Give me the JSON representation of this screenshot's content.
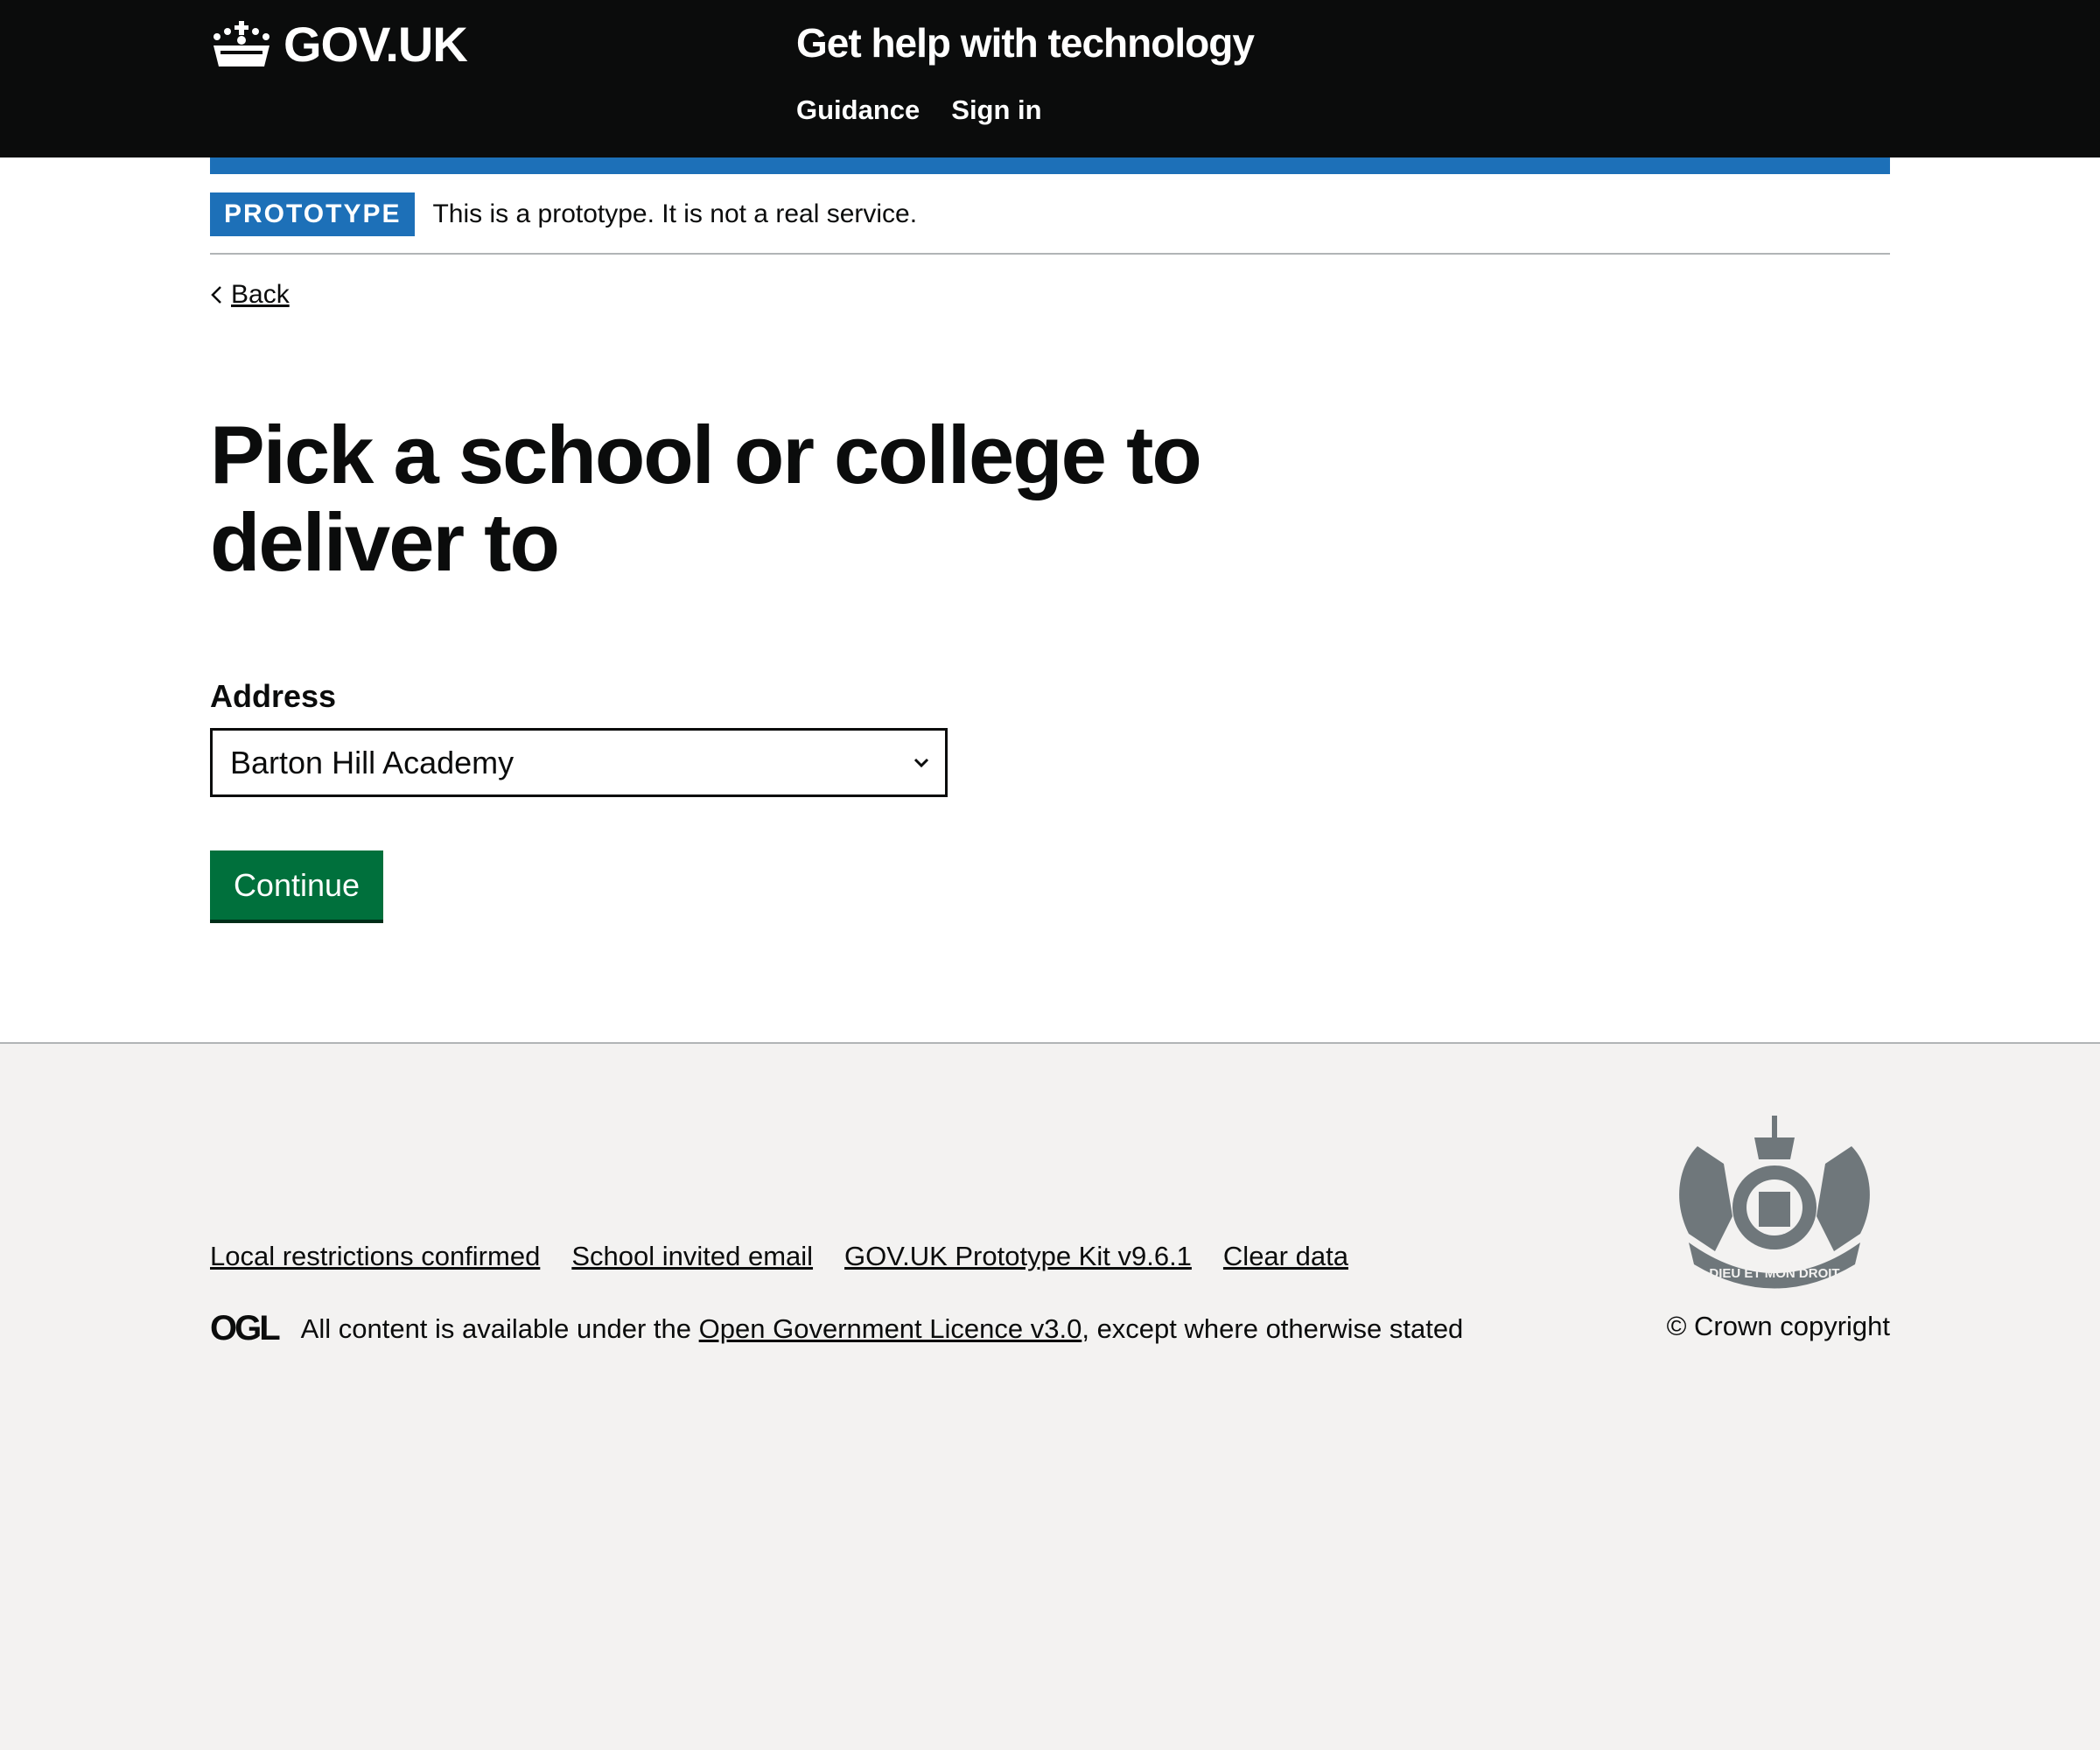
{
  "header": {
    "logo": "GOV.UK",
    "service": "Get help with technology",
    "nav": [
      "Guidance",
      "Sign in"
    ]
  },
  "phase": {
    "tag": "PROTOTYPE",
    "text": "This is a prototype. It is not a real service."
  },
  "back": "Back",
  "page": {
    "title": "Pick a school or college to deliver to",
    "label": "Address",
    "selected": "Barton Hill Academy",
    "continue": "Continue"
  },
  "footer": {
    "links": [
      "Local restrictions confirmed",
      "School invited email",
      "GOV.UK Prototype Kit v9.6.1",
      "Clear data"
    ],
    "ogl": "OGL",
    "licence_pre": "All content is available under the",
    "licence_link": "Open Government Licence v3.0",
    "licence_post": ", except where otherwise stated",
    "copyright": "© Crown copyright",
    "crest_motto": "DIEU ET MON DROIT"
  },
  "colors": {
    "header": "#0b0c0c",
    "blue": "#1d70b8",
    "green": "#00703c",
    "footer": "#f3f2f1"
  }
}
